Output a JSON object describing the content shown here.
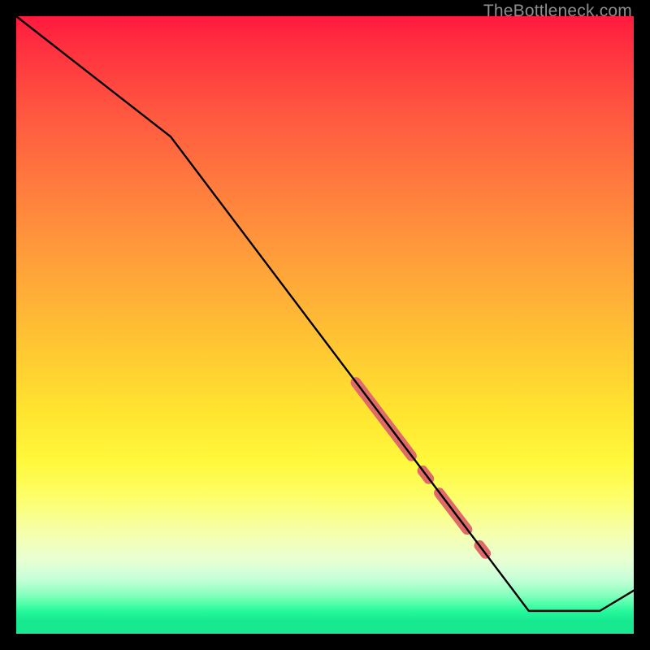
{
  "watermark": "TheBottleneck.com",
  "colors": {
    "background": "#000000",
    "line": "#000000",
    "highlight": "#e06a6a",
    "gradient_top": "#ff1a3e",
    "gradient_bottom": "#18e890"
  },
  "chart_data": {
    "type": "line",
    "title": "",
    "xlabel": "",
    "ylabel": "",
    "xlim": [
      0,
      100
    ],
    "ylim": [
      0,
      100
    ],
    "grid": false,
    "series": [
      {
        "name": "bottleneck-curve",
        "x": [
          0,
          25,
          83,
          94.5,
          100
        ],
        "values": [
          100,
          80.5,
          3.7,
          3.7,
          7.0
        ],
        "note": "y is percent height from bottom of the gradient box; curve descends, flattens near the bottom, then rises slightly at the right edge"
      }
    ],
    "highlights": [
      {
        "name": "segment-a",
        "x_start": 55.0,
        "y_start": 40.7,
        "x_end": 64.0,
        "y_end": 28.8
      },
      {
        "name": "dot-a",
        "x_start": 65.8,
        "y_start": 26.4,
        "x_end": 66.8,
        "y_end": 25.1
      },
      {
        "name": "segment-b",
        "x_start": 68.5,
        "y_start": 22.8,
        "x_end": 73.0,
        "y_end": 16.9
      },
      {
        "name": "dot-b",
        "x_start": 75.0,
        "y_start": 14.3,
        "x_end": 76.0,
        "y_end": 13.0
      }
    ]
  }
}
